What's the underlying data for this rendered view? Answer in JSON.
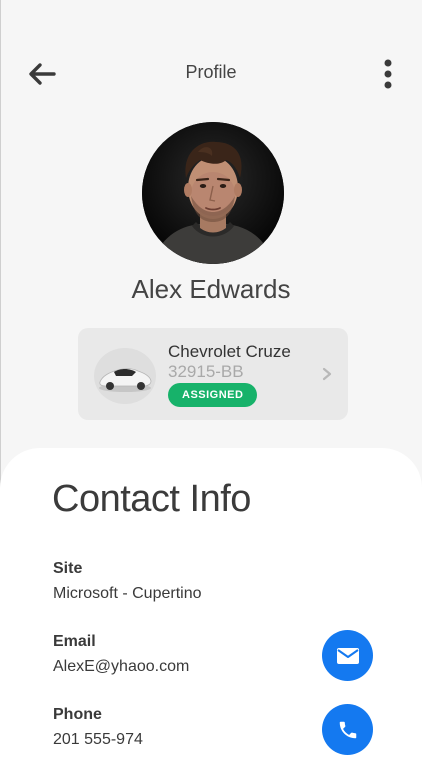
{
  "header": {
    "title": "Profile",
    "back_icon": "arrow-left-icon",
    "more_icon": "more-vertical-icon"
  },
  "profile": {
    "name": "Alex Edwards",
    "avatar": "avatar-photo"
  },
  "vehicle": {
    "name": "Chevrolet Cruze",
    "plate": "32915-BB",
    "status": "ASSIGNED",
    "status_color": "#17b26a",
    "icon": "car-icon"
  },
  "contact": {
    "title": "Contact Info",
    "fields": [
      {
        "label": "Site",
        "value": "Microsoft - Cupertino"
      },
      {
        "label": "Email",
        "value": "AlexE@yhaoo.com",
        "action_icon": "mail-icon"
      },
      {
        "label": "Phone",
        "value": "201 555-974",
        "action_icon": "phone-icon"
      }
    ],
    "accent_color": "#1479f0"
  }
}
